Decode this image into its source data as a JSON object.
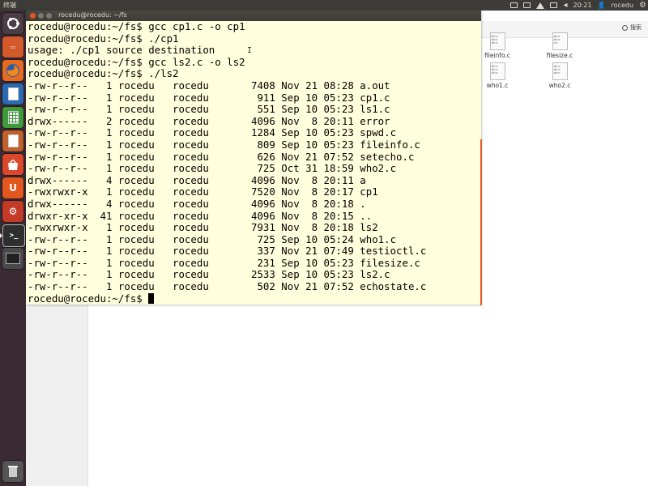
{
  "top_panel": {
    "app_title": "终端",
    "clock": "20:21",
    "user": "rocedu"
  },
  "launcher": {
    "icons": [
      "ubuntu-dash-icon",
      "files-icon",
      "firefox-icon",
      "writer-icon",
      "calc-icon",
      "impress-icon",
      "software-center-icon",
      "ubuntu-one-icon",
      "settings-icon",
      "terminal-icon",
      "terminal-2-icon",
      "trash-icon"
    ]
  },
  "terminal": {
    "title": "rocedu@rocedu: ~/fs",
    "lines": [
      "rocedu@rocedu:~/fs$ gcc cp1.c -o cp1",
      "rocedu@rocedu:~/fs$ ./cp1",
      "usage: ./cp1 source destination",
      "rocedu@rocedu:~/fs$ gcc ls2.c -o ls2",
      "rocedu@rocedu:~/fs$ ./ls2",
      "-rw-r--r--   1 rocedu   rocedu       7408 Nov 21 08:28 a.out",
      "-rw-r--r--   1 rocedu   rocedu        911 Sep 10 05:23 cp1.c",
      "-rw-r--r--   1 rocedu   rocedu        551 Sep 10 05:23 ls1.c",
      "drwx------   2 rocedu   rocedu       4096 Nov  8 20:11 error",
      "-rw-r--r--   1 rocedu   rocedu       1284 Sep 10 05:23 spwd.c",
      "-rw-r--r--   1 rocedu   rocedu        809 Sep 10 05:23 fileinfo.c",
      "-rw-r--r--   1 rocedu   rocedu        626 Nov 21 07:52 setecho.c",
      "-rw-r--r--   1 rocedu   rocedu        725 Oct 31 18:59 who2.c",
      "drwx------   4 rocedu   rocedu       4096 Nov  8 20:11 a",
      "-rwxrwxr-x   1 rocedu   rocedu       7520 Nov  8 20:17 cp1",
      "drwx------   4 rocedu   rocedu       4096 Nov  8 20:18 .",
      "drwxr-xr-x  41 rocedu   rocedu       4096 Nov  8 20:15 ..",
      "-rwxrwxr-x   1 rocedu   rocedu       7931 Nov  8 20:18 ls2",
      "-rw-r--r--   1 rocedu   rocedu        725 Sep 10 05:24 who1.c",
      "-rw-r--r--   1 rocedu   rocedu        337 Nov 21 07:49 testioctl.c",
      "-rw-r--r--   1 rocedu   rocedu        231 Sep 10 05:23 filesize.c",
      "-rw-r--r--   1 rocedu   rocedu       2533 Sep 10 05:23 ls2.c",
      "-rw-r--r--   1 rocedu   rocedu        502 Nov 21 07:52 echostate.c"
    ],
    "prompt": "rocedu@rocedu:~/fs$ "
  },
  "file_manager": {
    "search_label": "搜索",
    "files": [
      {
        "name": "fileinfo.c"
      },
      {
        "name": "filesize.c"
      },
      {
        "name": "who1.c"
      },
      {
        "name": "who2.c"
      }
    ]
  },
  "colors": {
    "terminal_bg": "#ffffdd",
    "panel_bg": "#3c3b37",
    "launcher_bg": "#3a2a33",
    "close_button": "#e95420"
  }
}
